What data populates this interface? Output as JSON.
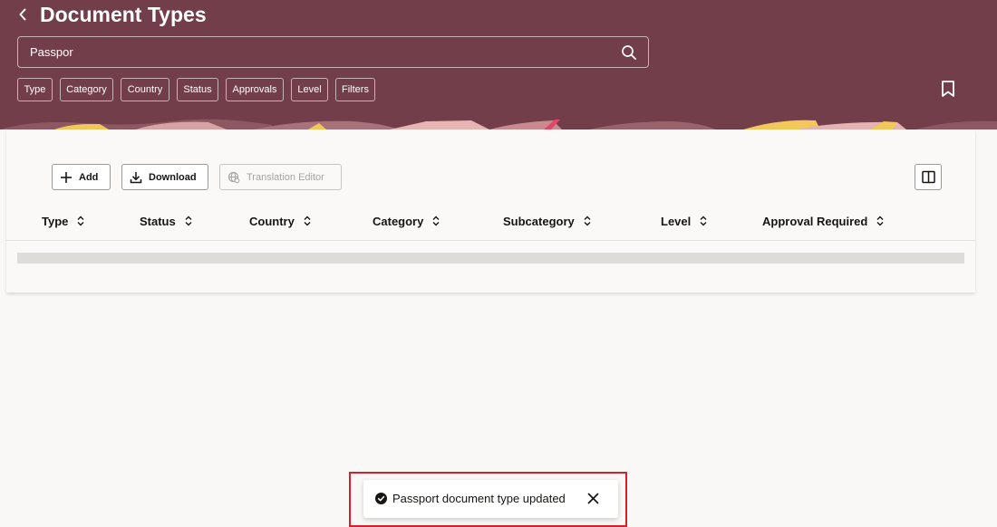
{
  "header": {
    "title": "Document Types",
    "search_value": "Passpor",
    "filter_chips": [
      "Type",
      "Category",
      "Country",
      "Status",
      "Approvals",
      "Level",
      "Filters"
    ],
    "icons": {
      "back": "chevron-left-icon",
      "search": "search-icon",
      "bookmark": "bookmark-icon"
    },
    "colors": {
      "header_bg": "#713e4a",
      "banner_accent": "#f2c85b"
    }
  },
  "toolbar": {
    "add_label": "Add",
    "download_label": "Download",
    "translation_editor_label": "Translation Editor",
    "icons": {
      "add": "plus-icon",
      "download": "download-icon",
      "translation": "globe-icon",
      "columns": "columns-icon"
    }
  },
  "table": {
    "columns": [
      "Type",
      "Status",
      "Country",
      "Category",
      "Subcategory",
      "Level",
      "Approval Required"
    ],
    "sort_icon": "sort-icon"
  },
  "toast": {
    "message": "Passport document type updated",
    "icons": {
      "status": "check-circle-icon",
      "close": "close-icon"
    },
    "highlight_color": "#d72027"
  }
}
